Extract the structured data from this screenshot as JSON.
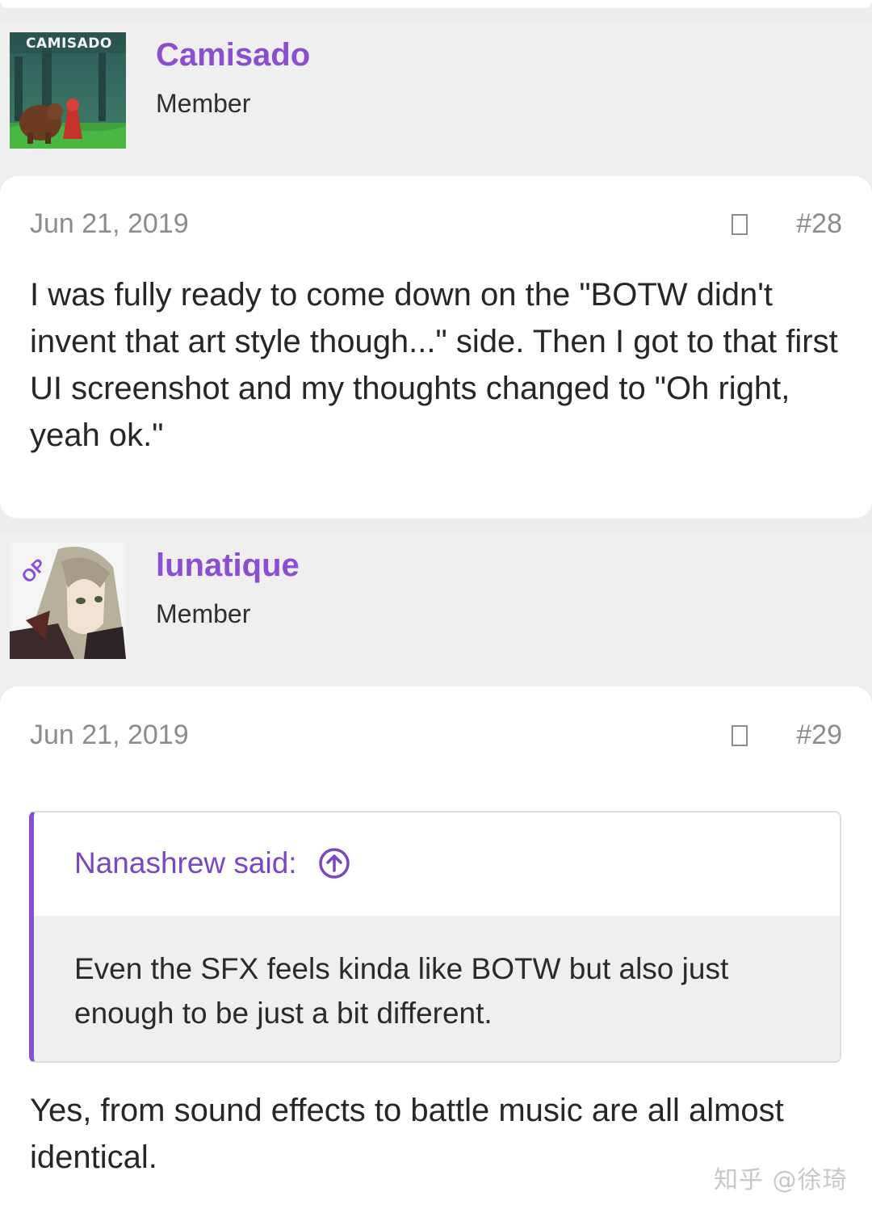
{
  "posts": [
    {
      "author": {
        "name": "Camisado",
        "role": "Member",
        "avatar_text": "CAMISADO"
      },
      "date": "Jun 21, 2019",
      "number": "#28",
      "body": "I was fully ready to come down on the \"BOTW didn't invent that art style though...\" side. Then I got to that first UI screenshot and my thoughts changed to \"Oh right, yeah ok.\""
    },
    {
      "author": {
        "name": "lunatique",
        "role": "Member",
        "badge": "OP"
      },
      "date": "Jun 21, 2019",
      "number": "#29",
      "quote": {
        "author_label": "Nanashrew said:",
        "text": "Even the SFX feels kinda like BOTW but also just enough to be just a bit different."
      },
      "body": "Yes, from sound effects to battle music are all almost identical."
    }
  ],
  "watermark": "知乎 @徐琦",
  "colors": {
    "accent": "#8a4fd0",
    "page_background": "#ededed",
    "card_background": "#ffffff",
    "meta_text": "#8c8c8c"
  },
  "icons": {
    "share": "share-icon",
    "jump_to_quote": "arrow-up-circle-icon"
  }
}
